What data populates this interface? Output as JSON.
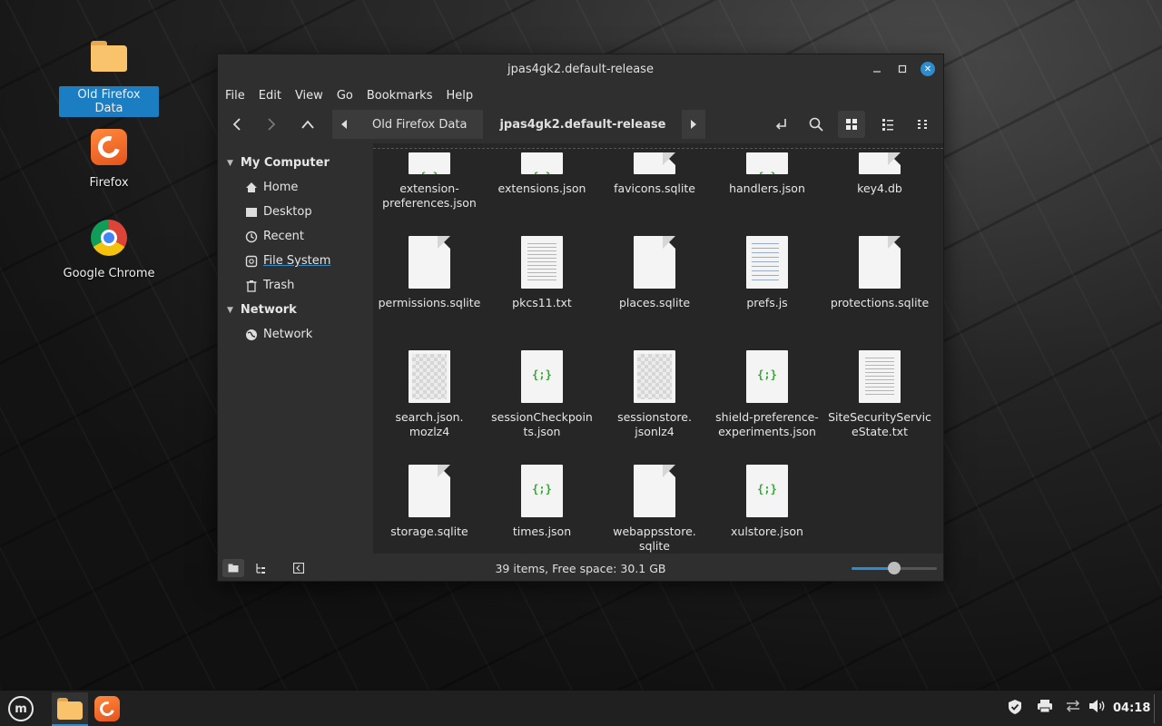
{
  "desktop": {
    "icons": [
      {
        "label": "Old Firefox Data",
        "icon": "folder-icon"
      },
      {
        "label": "Firefox",
        "icon": "firefox-icon"
      },
      {
        "label": "Google Chrome",
        "icon": "chrome-icon"
      }
    ]
  },
  "window": {
    "title": "jpas4gk2.default-release",
    "menu": [
      "File",
      "Edit",
      "View",
      "Go",
      "Bookmarks",
      "Help"
    ],
    "breadcrumb": [
      "Old Firefox Data",
      "jpas4gk2.default-release"
    ],
    "sidebar": {
      "sections": [
        {
          "title": "My Computer",
          "items": [
            {
              "label": "Home",
              "icon": "home-icon"
            },
            {
              "label": "Desktop",
              "icon": "desktop-icon"
            },
            {
              "label": "Recent",
              "icon": "recent-icon"
            },
            {
              "label": "File System",
              "icon": "drive-icon"
            },
            {
              "label": "Trash",
              "icon": "trash-icon"
            }
          ]
        },
        {
          "title": "Network",
          "items": [
            {
              "label": "Network",
              "icon": "network-icon"
            }
          ]
        }
      ]
    },
    "files": [
      {
        "name": "extension-\npreferences.json",
        "type": "json"
      },
      {
        "name": "extensions.json",
        "type": "json"
      },
      {
        "name": "favicons.sqlite",
        "type": "blank"
      },
      {
        "name": "handlers.json",
        "type": "json"
      },
      {
        "name": "key4.db",
        "type": "blank"
      },
      {
        "name": "permissions.sqlite",
        "type": "blank"
      },
      {
        "name": "pkcs11.txt",
        "type": "text"
      },
      {
        "name": "places.sqlite",
        "type": "blank"
      },
      {
        "name": "prefs.js",
        "type": "code"
      },
      {
        "name": "protections.sqlite",
        "type": "blank"
      },
      {
        "name": "search.json.\nmozlz4",
        "type": "binary"
      },
      {
        "name": "sessionCheckpoin\nts.json",
        "type": "json"
      },
      {
        "name": "sessionstore.\njsonlz4",
        "type": "binary"
      },
      {
        "name": "shield-preference-\nexperiments.json",
        "type": "json"
      },
      {
        "name": "SiteSecurityServic\neState.txt",
        "type": "text"
      },
      {
        "name": "storage.sqlite",
        "type": "blank"
      },
      {
        "name": "times.json",
        "type": "json"
      },
      {
        "name": "webappsstore.\nsqlite",
        "type": "blank"
      },
      {
        "name": "xulstore.json",
        "type": "json"
      }
    ],
    "json_glyph": "{;}",
    "status": "39 items, Free space: 30.1 GB",
    "zoom_level": 0.5
  },
  "taskbar": {
    "clock": "04:18",
    "menu_logo": "m",
    "tray_icons": [
      "shield-icon",
      "printer-icon",
      "network-icon",
      "volume-icon"
    ]
  },
  "colors": {
    "accent": "#2d8ccb",
    "json_green": "#3aa63a",
    "window_bg": "#2f2f2f",
    "content_bg": "#262626"
  }
}
